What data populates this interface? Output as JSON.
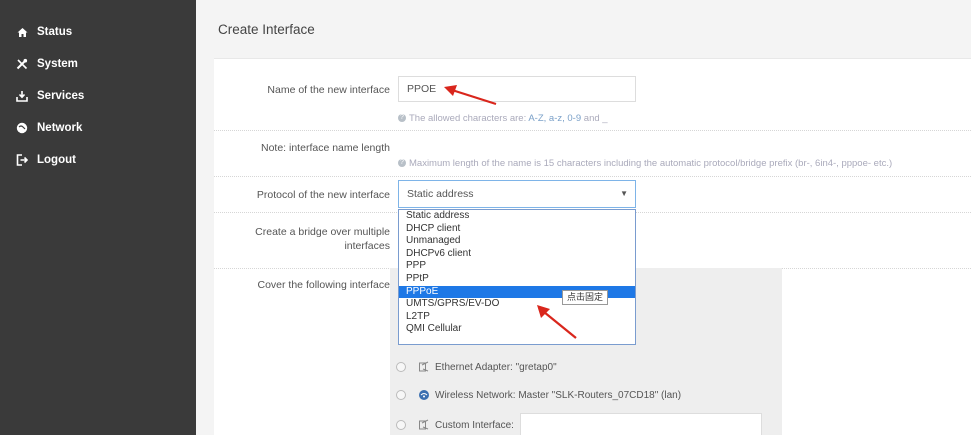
{
  "sidebar": {
    "items": [
      {
        "label": "Status",
        "icon": "home-icon"
      },
      {
        "label": "System",
        "icon": "tools-icon"
      },
      {
        "label": "Services",
        "icon": "services-icon"
      },
      {
        "label": "Network",
        "icon": "network-icon"
      },
      {
        "label": "Logout",
        "icon": "logout-icon"
      }
    ]
  },
  "page": {
    "title": "Create Interface"
  },
  "form": {
    "name": {
      "label": "Name of the new interface",
      "value": "PPOE",
      "hint_prefix": "The allowed characters are: ",
      "hint_codes": "A-Z, a-z, 0-9",
      "hint_suffix": " and _"
    },
    "note": {
      "label": "Note: interface name length",
      "hint": "Maximum length of the name is 15 characters including the automatic protocol/bridge prefix (br-, 6in4-, pppoe- etc.)"
    },
    "protocol": {
      "label": "Protocol of the new interface",
      "selected": "Static address",
      "options": [
        "Static address",
        "DHCP client",
        "Unmanaged",
        "DHCPv6 client",
        "PPP",
        "PPtP",
        "PPPoE",
        "UMTS/GPRS/EV-DO",
        "L2TP",
        "QMI Cellular"
      ],
      "highlighted": "PPPoE",
      "tooltip": "点击固定"
    },
    "bridge": {
      "label_line1": "Create a bridge over multiple",
      "label_line2": "interfaces"
    },
    "cover": {
      "label": "Cover the following interface",
      "interfaces": [
        {
          "label": "Ethernet Adapter: \"gretap0\"",
          "icon": "ethernet-icon"
        },
        {
          "label": "Wireless Network: Master \"SLK-Routers_07CD18\" (lan)",
          "icon": "wireless-icon"
        },
        {
          "label": "Custom Interface:",
          "icon": "ethernet-icon"
        }
      ]
    }
  },
  "colors": {
    "sidebar_bg": "#3a3a3a",
    "accent": "#1e78e6",
    "arrow": "#d9261c"
  }
}
